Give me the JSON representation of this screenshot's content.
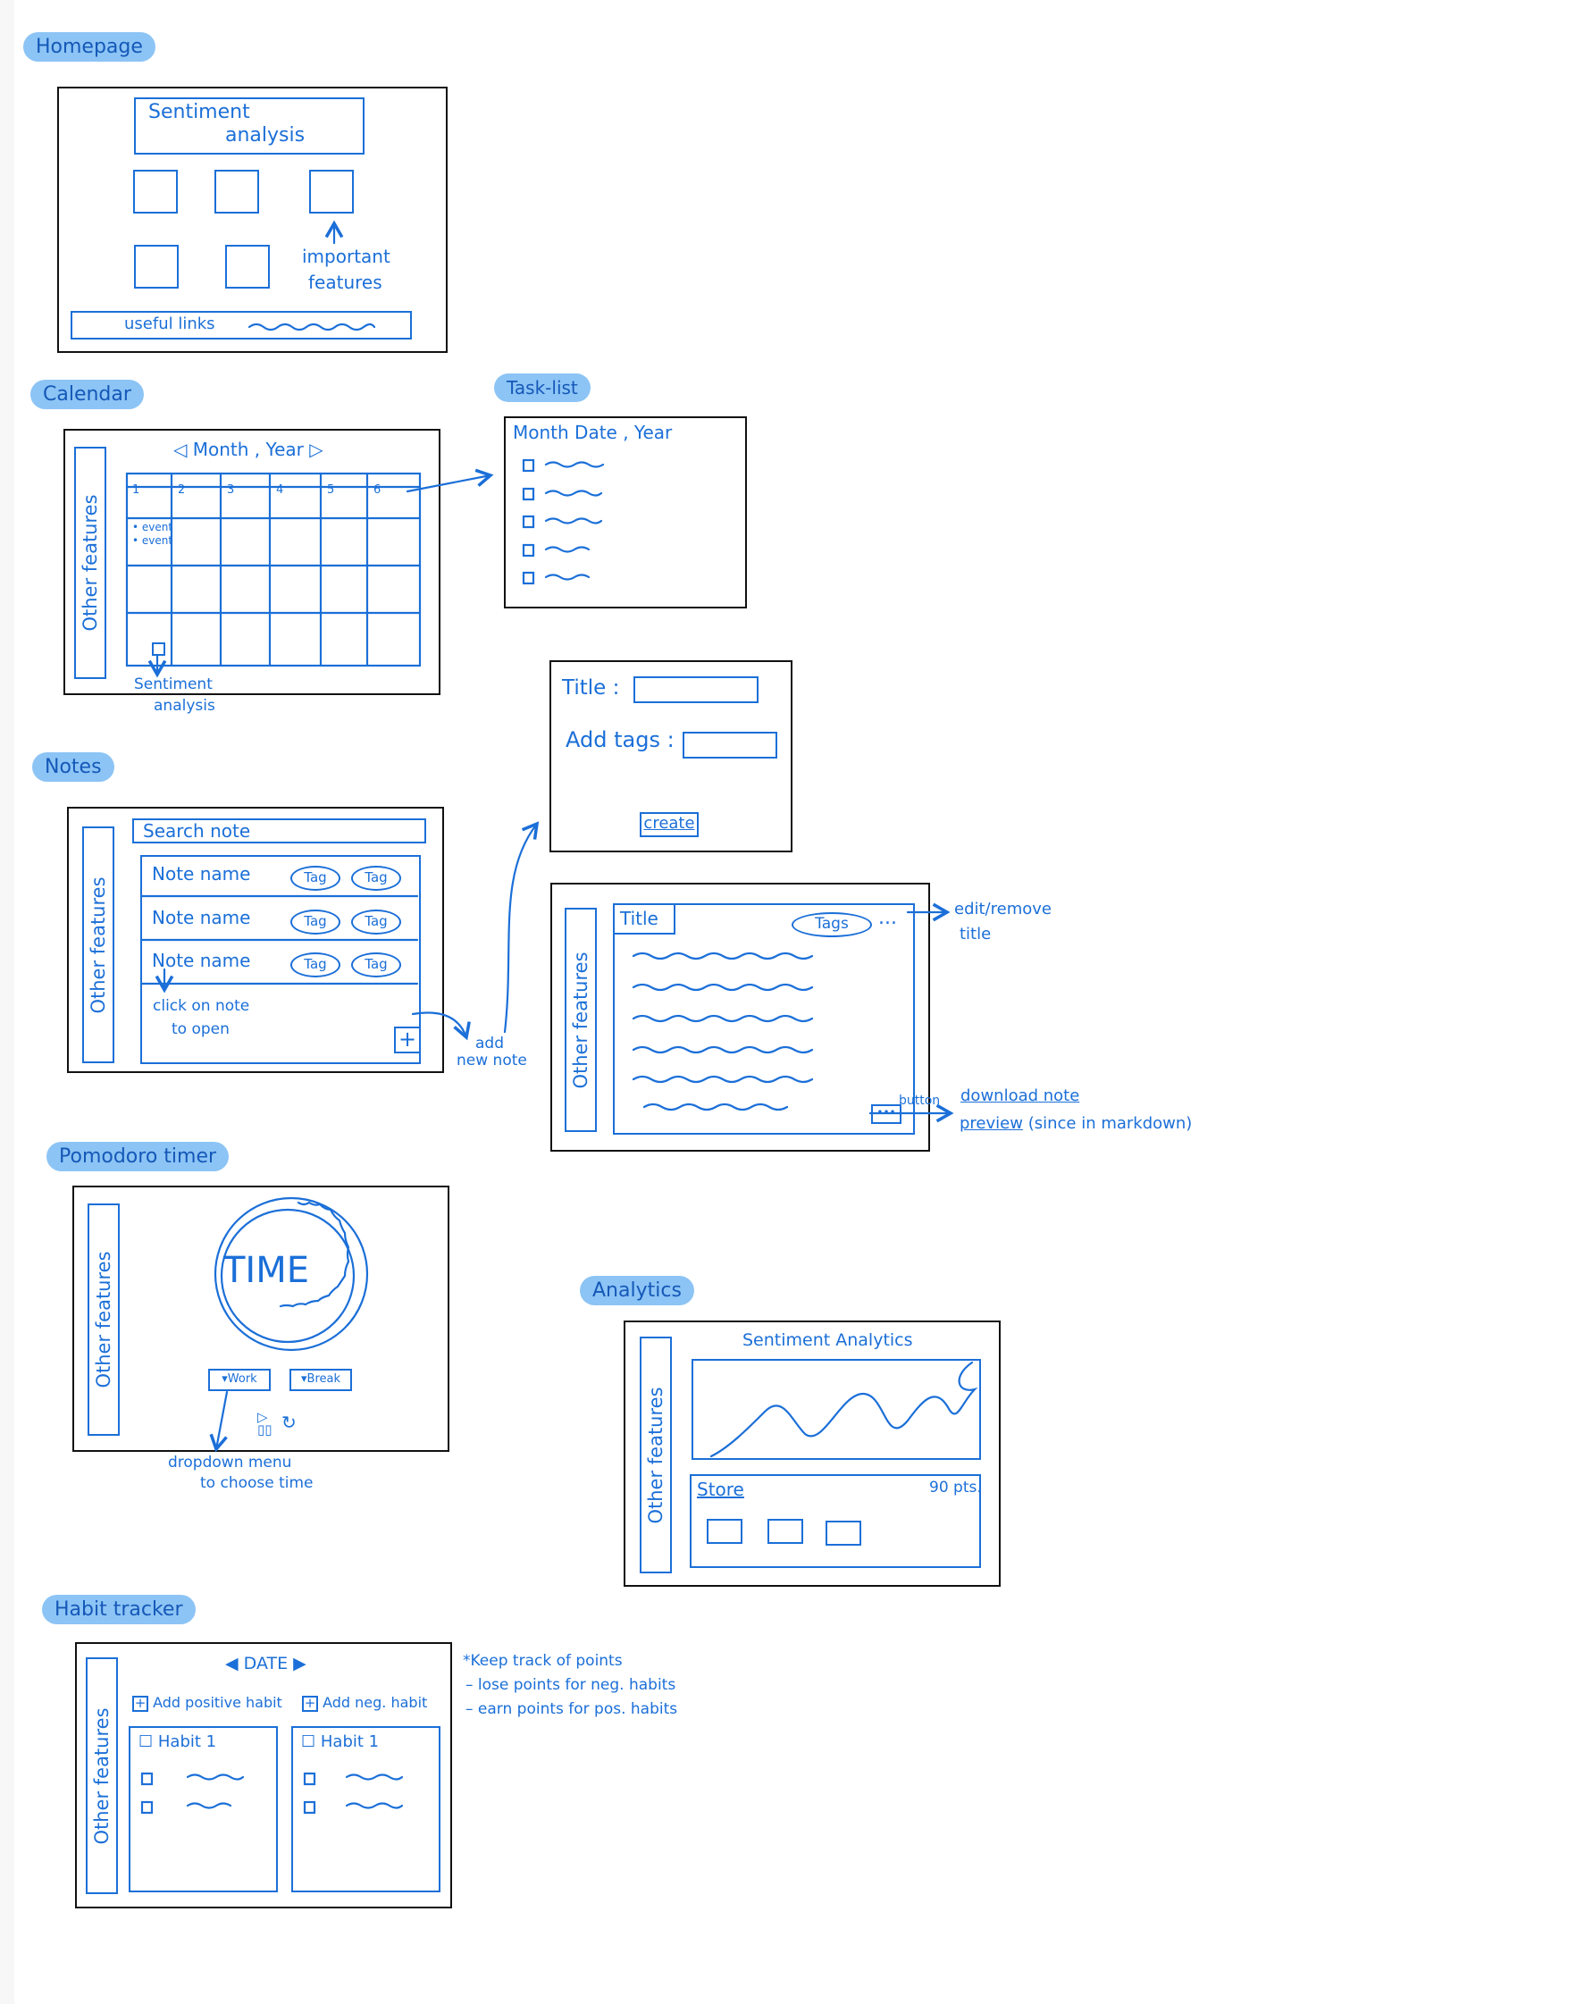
{
  "labels": {
    "homepage": "Homepage",
    "calendar": "Calendar",
    "task_list": "Task-list",
    "notes": "Notes",
    "pomodoro": "Pomodoro timer",
    "analytics": "Analytics",
    "habit": "Habit tracker"
  },
  "homepage": {
    "banner_line1": "Sentiment",
    "banner_line2": "analysis",
    "features_line1": "important",
    "features_line2": "features",
    "links": "useful links"
  },
  "common": {
    "other_features": "Other features"
  },
  "calendar": {
    "header": "Month , Year",
    "days": [
      "1",
      "2",
      "3",
      "4",
      "5",
      "6"
    ],
    "events": [
      "• event",
      "• event"
    ],
    "sa_line1": "Sentiment",
    "sa_line2": "analysis"
  },
  "task_list": {
    "header": "Month Date , Year"
  },
  "notes": {
    "search": "Search note",
    "items": [
      "Note name",
      "Note name",
      "Note name"
    ],
    "tag": "Tag",
    "hint_line1": "click on note",
    "hint_line2": "to open",
    "add_line1": "add",
    "add_line2": "new note"
  },
  "new_note": {
    "title_label": "Title :",
    "tags_label": "Add tags :",
    "create": "create"
  },
  "note_view": {
    "title": "Title",
    "tags": "Tags",
    "dots": "...",
    "edit_line1": "edit/remove",
    "edit_line2": "title",
    "button_word": "button",
    "download": "download note",
    "preview": "preview",
    "preview_note": "(since in markdown)"
  },
  "pomodoro": {
    "time": "TIME",
    "work": "▾Work",
    "break": "▾Break",
    "dropdown_line1": "dropdown menu",
    "dropdown_line2": "to choose time"
  },
  "analytics": {
    "title": "Sentiment Analytics",
    "store": "Store",
    "points": "90 pts."
  },
  "habit": {
    "date": "DATE",
    "add_pos": "Add positive habit",
    "add_neg": "Add neg. habit",
    "habit1": "Habit 1",
    "note_line1": "*Keep track of points",
    "note_line2": "– lose points for neg. habits",
    "note_line3": "– earn points for pos. habits"
  }
}
